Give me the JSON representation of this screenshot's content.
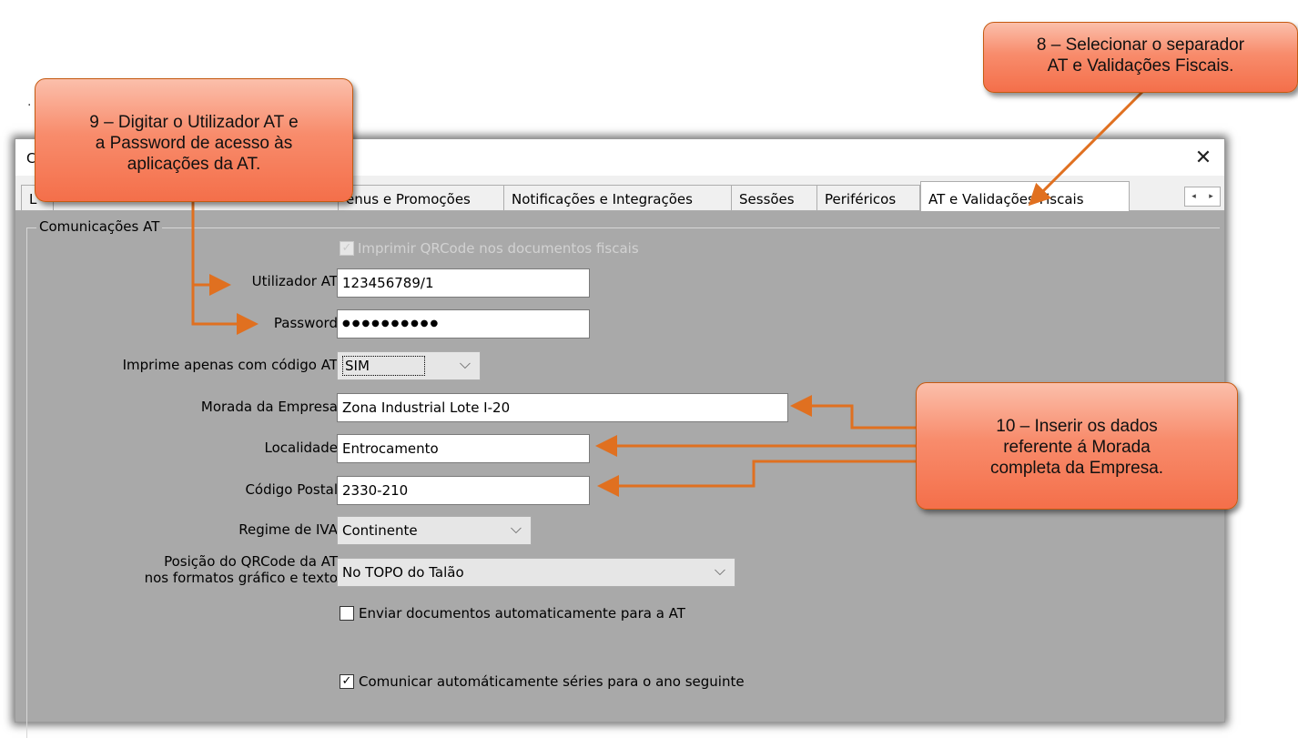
{
  "stray_mark": ".",
  "dialog": {
    "title": "C",
    "close_glyph": "✕",
    "tabs": [
      {
        "label": "L"
      },
      {
        "label": "enus e Promoções"
      },
      {
        "label": "Notificações e Integrações"
      },
      {
        "label": "Sessões"
      },
      {
        "label": "Periféricos"
      },
      {
        "label": "AT e Validações Fiscais",
        "active": true
      }
    ],
    "tab_scroll": {
      "left": "◂",
      "right": "▸"
    },
    "group": {
      "title": "Comunicações AT",
      "qrcode_checkbox": {
        "label": "Imprimir QRCode nos documentos fiscais",
        "checked": true,
        "disabled": true
      },
      "utilizador_at": {
        "label": "Utilizador AT",
        "value": "123456789/1"
      },
      "password": {
        "label": "Password",
        "value": "●●●●●●●●●●"
      },
      "imprime_codigo_at": {
        "label": "Imprime apenas com código AT",
        "value": "SIM"
      },
      "morada": {
        "label": "Morada da Empresa",
        "value": "Zona Industrial Lote I-20"
      },
      "localidade": {
        "label": "Localidade",
        "value": "Entrocamento"
      },
      "codigo_postal": {
        "label": "Código Postal",
        "value": "2330-210"
      },
      "regime_iva": {
        "label": "Regime de IVA",
        "value": "Continente"
      },
      "posicao_qrcode": {
        "label_line1": "Posição do QRCode da AT",
        "label_line2": "nos formatos gráfico e texto",
        "value": "No TOPO do Talão"
      },
      "enviar_docs": {
        "label": "Enviar documentos automaticamente para a AT",
        "checked": false
      },
      "comunicar_series": {
        "label": "Comunicar automáticamente séries para o ano seguinte",
        "checked": true
      },
      "chevron_glyph": "⌵",
      "check_glyph": "✓"
    }
  },
  "callouts": {
    "step8": {
      "line1": "8 – Selecionar o separador",
      "line2": "AT e Validações Fiscais."
    },
    "step9": {
      "line1": "9 – Digitar o Utilizador AT e",
      "line2": "a Password de acesso às",
      "line3": "aplicações da AT."
    },
    "step10": {
      "line1": "10 – Inserir os dados",
      "line2": "referente á Morada",
      "line3": "completa da Empresa."
    }
  },
  "colors": {
    "callout_border": "#c55a11",
    "callout_fill": "#f46f4a",
    "arrow": "#e07020",
    "panel_bg": "#a9a9a9"
  }
}
